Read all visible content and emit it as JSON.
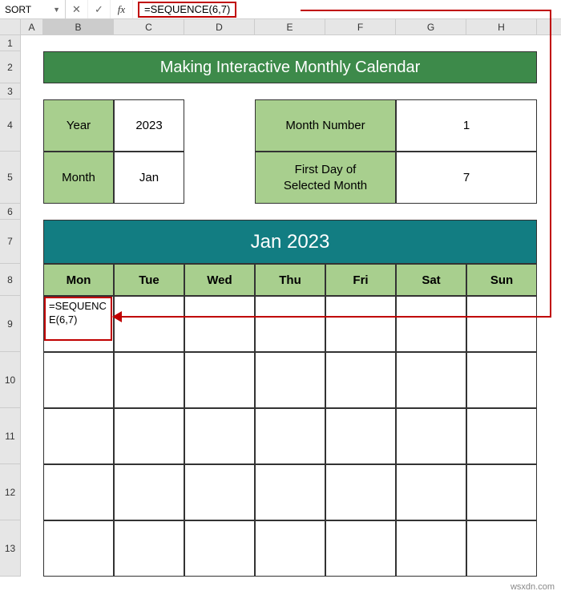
{
  "formula_bar": {
    "name_box": "SORT",
    "cancel": "✕",
    "accept": "✓",
    "fx": "fx",
    "formula": "=SEQUENCE(6,7)"
  },
  "columns": [
    "A",
    "B",
    "C",
    "D",
    "E",
    "F",
    "G",
    "H"
  ],
  "rows": [
    "1",
    "2",
    "3",
    "4",
    "5",
    "6",
    "7",
    "8",
    "9",
    "10",
    "11",
    "12",
    "13"
  ],
  "title": "Making Interactive Monthly Calendar",
  "params": {
    "year_label": "Year",
    "year_value": "2023",
    "month_label": "Month",
    "month_value": "Jan",
    "mnum_label": "Month Number",
    "mnum_value": "1",
    "fday_label_1": "First Day of",
    "fday_label_2": "Selected Month",
    "fday_value": "7"
  },
  "cal_title": "Jan 2023",
  "days": [
    "Mon",
    "Tue",
    "Wed",
    "Thu",
    "Fri",
    "Sat",
    "Sun"
  ],
  "cell_formula": "=SEQUENCE(6,7)",
  "watermark": "wsxdn.com",
  "chart_data": {
    "type": "table",
    "title": "Making Interactive Monthly Calendar",
    "parameters": [
      {
        "label": "Year",
        "value": 2023
      },
      {
        "label": "Month",
        "value": "Jan"
      },
      {
        "label": "Month Number",
        "value": 1
      },
      {
        "label": "First Day of Selected Month",
        "value": 7
      }
    ],
    "calendar": {
      "title": "Jan 2023",
      "columns": [
        "Mon",
        "Tue",
        "Wed",
        "Thu",
        "Fri",
        "Sat",
        "Sun"
      ],
      "rows": 6,
      "formula_in_B9": "=SEQUENCE(6,7)"
    }
  }
}
